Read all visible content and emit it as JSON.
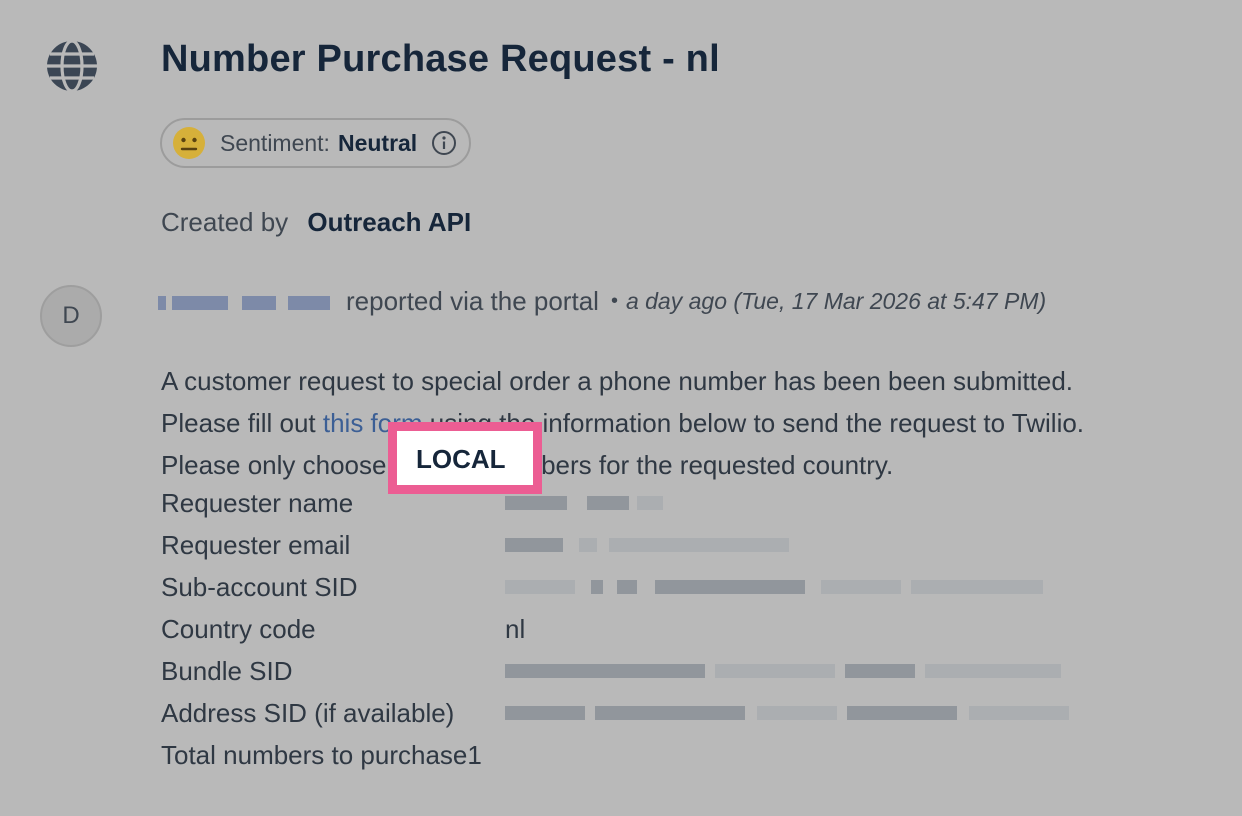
{
  "header": {
    "title": "Number Purchase Request - nl",
    "icon": "globe-icon"
  },
  "sentiment": {
    "label": "Sentiment:",
    "value": "Neutral",
    "icon": "neutral-face-icon",
    "info_icon": "info-icon"
  },
  "created": {
    "prefix": "Created by",
    "by": "Outreach API"
  },
  "reporter": {
    "avatar_letter": "D",
    "action": "reported via the portal",
    "separator": "•",
    "time": "a day ago (Tue, 17 Mar 2026 at 5:47 PM)"
  },
  "message": {
    "line1": "A customer request to special order a phone number has been been submitted.",
    "line2_pre": "Please fill out ",
    "line2_link": "this form",
    "line2_post": " using the information below to send the request to Twilio.",
    "line3_pre": "Please only choose ",
    "line3_bold": "LOCAL",
    "line3_post": " numbers for the requested country."
  },
  "fields": [
    {
      "label": "Requester name",
      "value": ""
    },
    {
      "label": "Requester email",
      "value": ""
    },
    {
      "label": "Sub-account SID",
      "value": ""
    },
    {
      "label": "Country code",
      "value": "nl"
    },
    {
      "label": "Bundle SID",
      "value": ""
    },
    {
      "label": "Address SID (if available)",
      "value": ""
    }
  ],
  "total": {
    "label": "Total numbers to purchase",
    "value": "1"
  },
  "colors": {
    "background": "#b9b9b9",
    "title": "#16263a",
    "highlight_border": "#ec5d93",
    "link": "#3c5f95"
  }
}
